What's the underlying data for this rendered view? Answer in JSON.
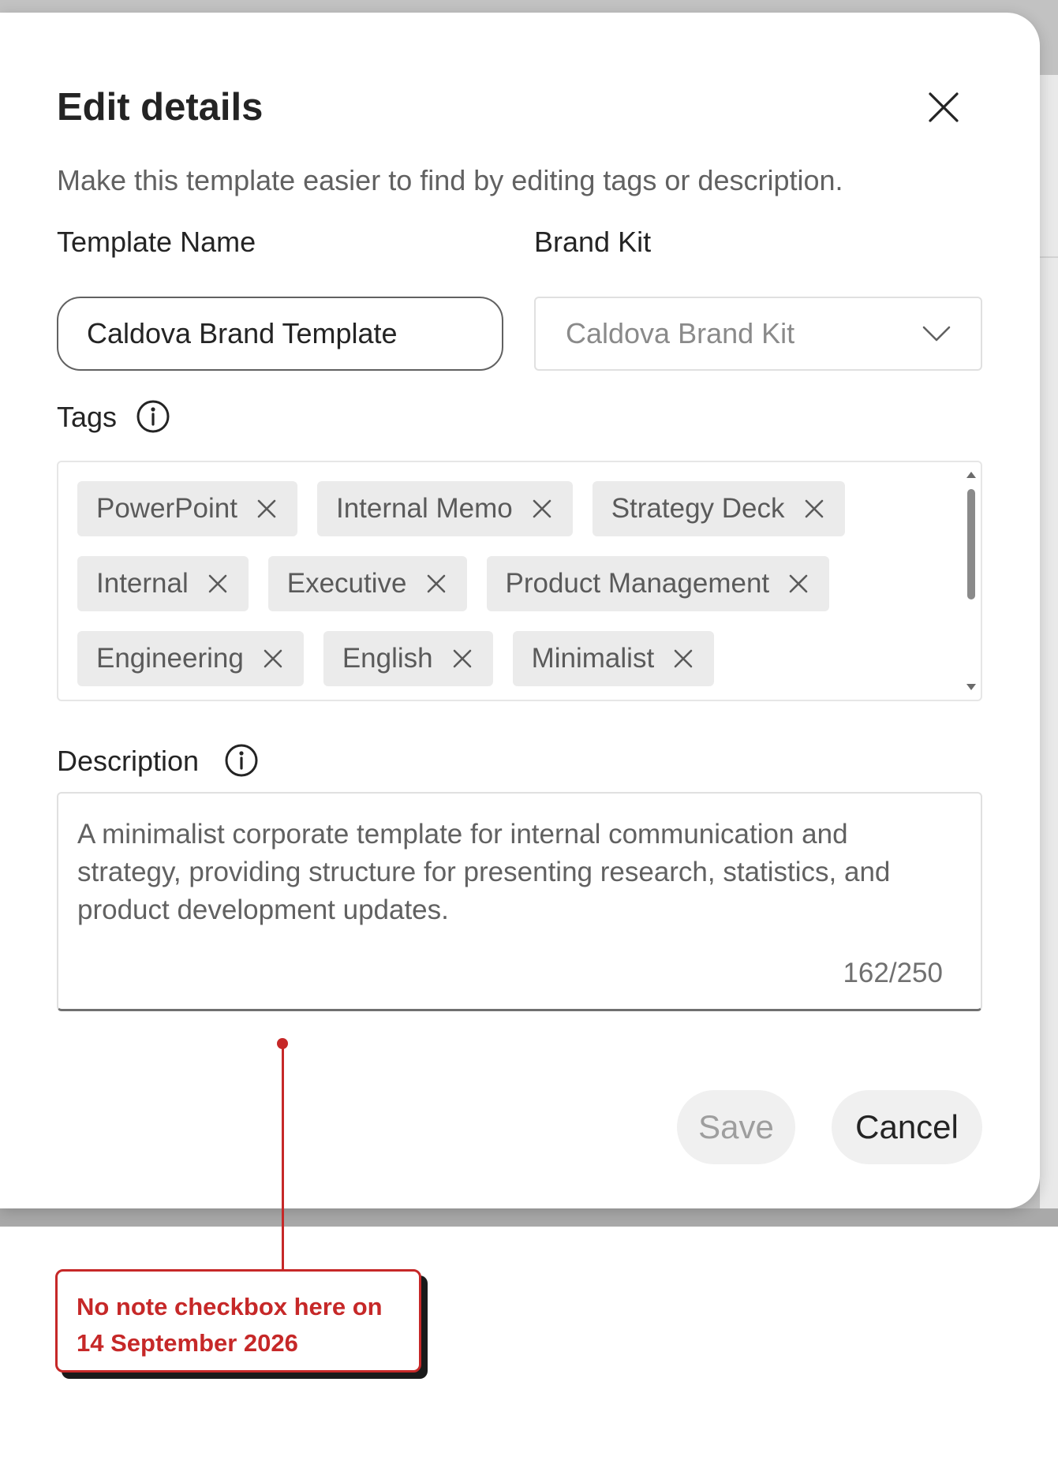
{
  "dialog": {
    "title": "Edit details",
    "subtitle": "Make this template easier to find by editing tags or description.",
    "close_icon": "close-icon"
  },
  "template_name": {
    "label": "Template Name",
    "value": "Caldova Brand Template"
  },
  "brand_kit": {
    "label": "Brand Kit",
    "value": "Caldova Brand Kit",
    "icon": "chevron-down-icon"
  },
  "tags": {
    "label": "Tags",
    "info_icon": "info-icon",
    "items": [
      {
        "label": "PowerPoint"
      },
      {
        "label": "Internal Memo"
      },
      {
        "label": "Strategy Deck"
      },
      {
        "label": "Internal"
      },
      {
        "label": "Executive"
      },
      {
        "label": "Product Management"
      },
      {
        "label": "Engineering"
      },
      {
        "label": "English"
      },
      {
        "label": "Minimalist"
      }
    ]
  },
  "description": {
    "label": "Description",
    "info_icon": "info-icon",
    "value": "A minimalist corporate template for internal communication and strategy, providing structure for presenting research, statistics, and product development updates.",
    "char_count": "162/250"
  },
  "actions": {
    "save_label": "Save",
    "cancel_label": "Cancel"
  },
  "annotation": {
    "text": "No note checkbox here on 14 September 2026",
    "color": "#c62828"
  }
}
